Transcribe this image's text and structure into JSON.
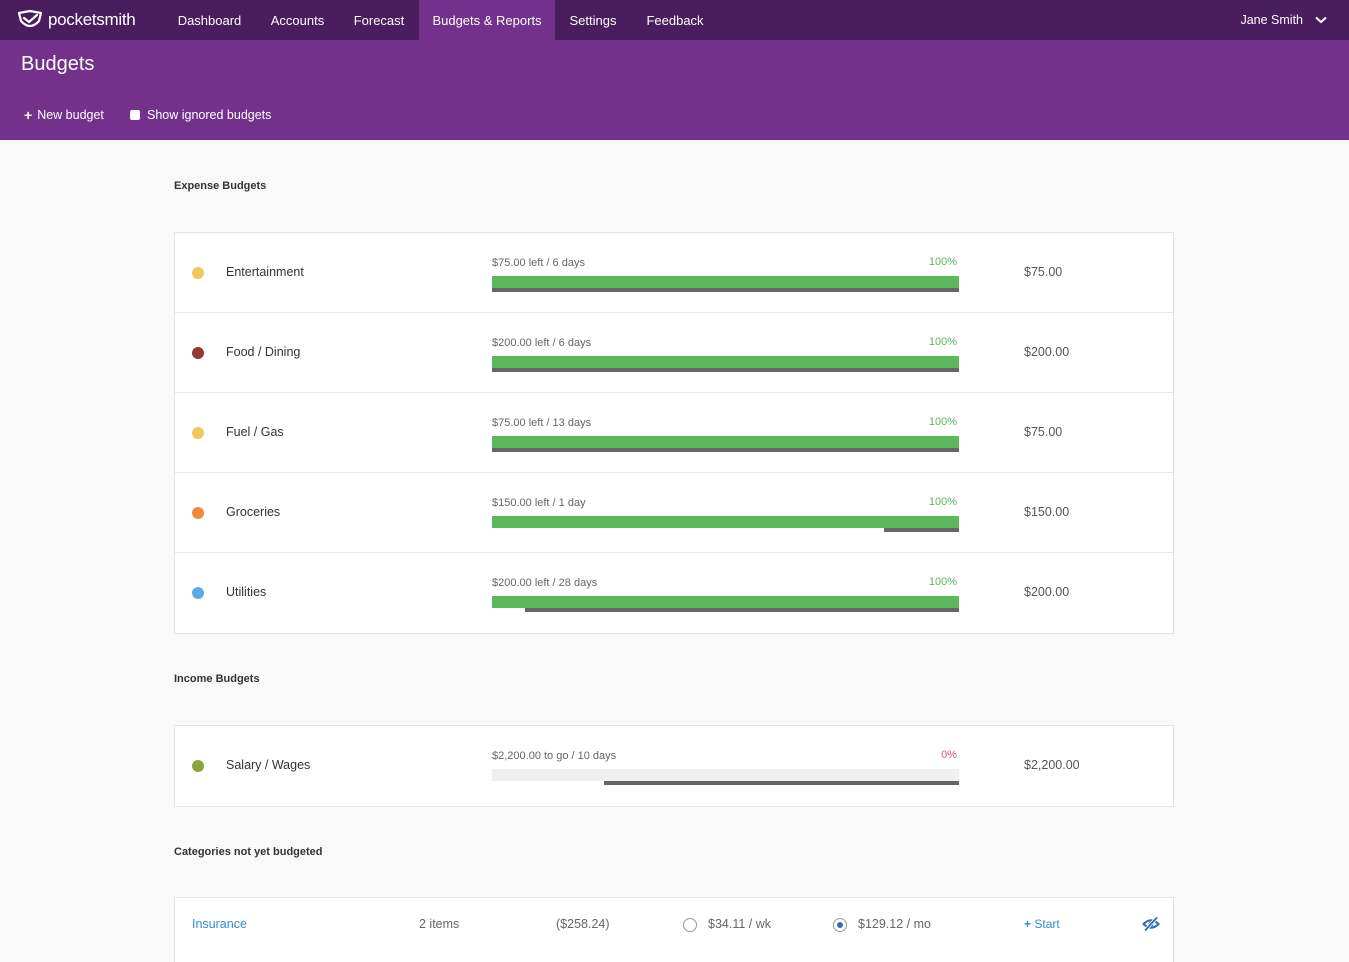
{
  "nav": {
    "brand": "pocketsmith",
    "items": [
      {
        "label": "Dashboard",
        "active": false
      },
      {
        "label": "Accounts",
        "active": false
      },
      {
        "label": "Forecast",
        "active": false
      },
      {
        "label": "Budgets & Reports",
        "active": true
      },
      {
        "label": "Settings",
        "active": false
      },
      {
        "label": "Feedback",
        "active": false
      }
    ],
    "user": "Jane Smith"
  },
  "header": {
    "title": "Budgets",
    "new_budget": "New budget",
    "show_ignored": "Show ignored budgets"
  },
  "expense": {
    "title": "Expense Budgets",
    "rows": [
      {
        "name": "Entertainment",
        "color": "#f0c95c",
        "label": "$75.00 left / 6 days",
        "pct": "100%",
        "fill": 1.0,
        "elapsed": 1.0,
        "amount": "$75.00"
      },
      {
        "name": "Food / Dining",
        "color": "#8f3b32",
        "label": "$200.00 left / 6 days",
        "pct": "100%",
        "fill": 1.0,
        "elapsed": 1.0,
        "amount": "$200.00"
      },
      {
        "name": "Fuel / Gas",
        "color": "#f0c95c",
        "label": "$75.00 left / 13 days",
        "pct": "100%",
        "fill": 1.0,
        "elapsed": 1.0,
        "amount": "$75.00"
      },
      {
        "name": "Groceries",
        "color": "#f08a3c",
        "label": "$150.00 left / 1 day",
        "pct": "100%",
        "fill": 1.0,
        "elapsed": 0.16,
        "amount": "$150.00"
      },
      {
        "name": "Utilities",
        "color": "#5da9e9",
        "label": "$200.00 left / 28 days",
        "pct": "100%",
        "fill": 1.0,
        "elapsed": 0.93,
        "amount": "$200.00"
      }
    ]
  },
  "income": {
    "title": "Income Budgets",
    "rows": [
      {
        "name": "Salary / Wages",
        "color": "#8ca33a",
        "label": "$2,200.00 to go / 10 days",
        "pct": "0%",
        "fill": 0.0,
        "elapsed": 0.76,
        "amount": "$2,200.00"
      }
    ]
  },
  "not_budgeted": {
    "title": "Categories not yet budgeted",
    "rows": [
      {
        "name": "Insurance",
        "items": "2 items",
        "total": "($258.24)",
        "weekly": "$34.11 / wk",
        "monthly": "$129.12 / mo",
        "selected": "monthly",
        "start": "Start"
      }
    ]
  },
  "colors": {
    "nav_bg": "#4a1d5e",
    "header_bg": "#73318c",
    "bar_green": "#5cb85c",
    "pct_green": "#5cb85c",
    "pct_pink": "#e24c8c",
    "link_blue": "#2d8fd5"
  }
}
